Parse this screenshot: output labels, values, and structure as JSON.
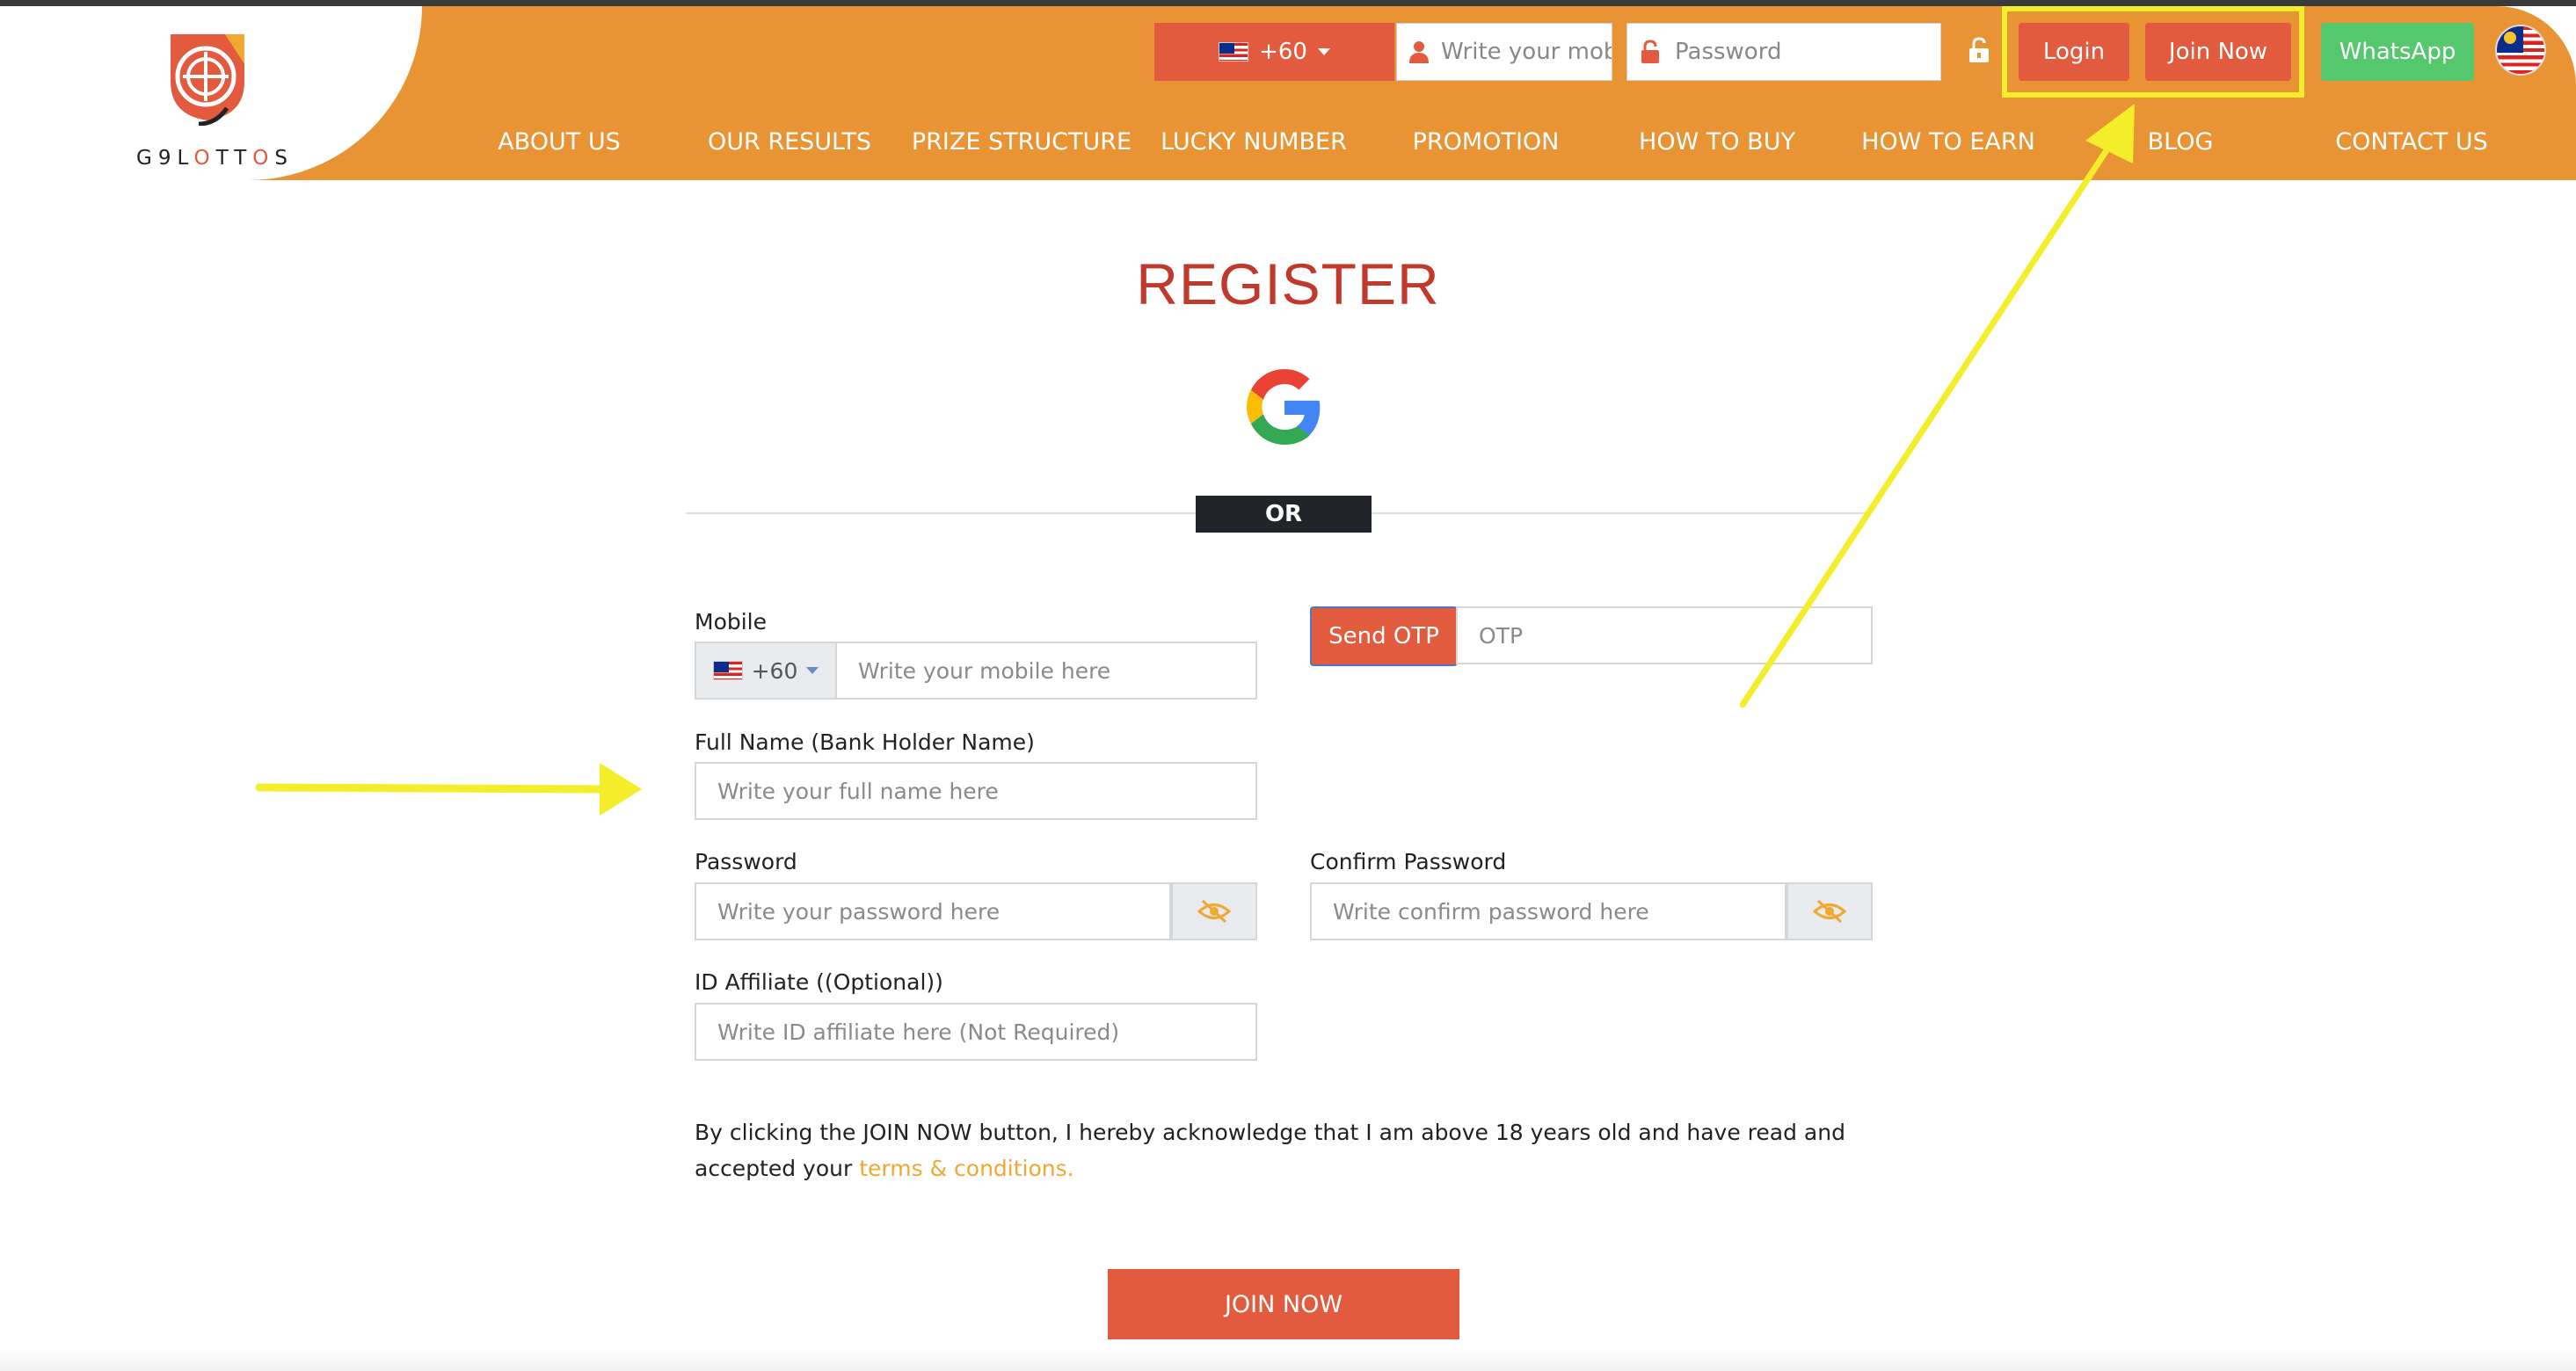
{
  "brand": {
    "logo_text_prefix": "G9L",
    "logo_text_o1": "O",
    "logo_text_mid": "TT",
    "logo_text_o2": "O",
    "logo_text_suffix": "S"
  },
  "header": {
    "country_code": "+60",
    "mobile_placeholder": "Write your mobile here",
    "password_placeholder": "Password",
    "login_label": "Login",
    "join_label": "Join Now",
    "whatsapp_label": "WhatsApp"
  },
  "nav": [
    {
      "label": "ABOUT US"
    },
    {
      "label": "OUR RESULTS"
    },
    {
      "label": "PRIZE STRUCTURE"
    },
    {
      "label": "LUCKY NUMBER"
    },
    {
      "label": "PROMOTION"
    },
    {
      "label": "HOW TO BUY"
    },
    {
      "label": "HOW TO EARN"
    },
    {
      "label": "BLOG"
    },
    {
      "label": "CONTACT US"
    }
  ],
  "register": {
    "title": "REGISTER",
    "or_label": "OR",
    "mobile_label": "Mobile",
    "mobile_code": "+60",
    "mobile_placeholder": "Write your mobile here",
    "send_otp_label": "Send OTP",
    "otp_placeholder": "OTP",
    "fullname_label": "Full Name (Bank Holder Name)",
    "fullname_placeholder": "Write your full name here",
    "password_label": "Password",
    "password_placeholder": "Write your password here",
    "confirm_label": "Confirm Password",
    "confirm_placeholder": "Write confirm password here",
    "affiliate_label": "ID Affiliate ((Optional))",
    "affiliate_placeholder": "Write ID affiliate here (Not Required)",
    "terms_text": "By clicking the JOIN NOW button, I hereby acknowledge that I am above 18 years old and have read and accepted your",
    "terms_link": "terms & conditions.",
    "join_button": "JOIN NOW"
  },
  "colors": {
    "header_orange": "#e99434",
    "accent_red": "#e25b3e",
    "title_red": "#c0392b",
    "whatsapp_green": "#55c76d",
    "annotation_yellow": "#f4ee2a",
    "link_yellow": "#f0a830"
  },
  "icons": [
    "user-icon",
    "lock-red-icon",
    "unlock-icon",
    "eye-slash-icon",
    "google-icon",
    "malaysia-flag-icon"
  ]
}
